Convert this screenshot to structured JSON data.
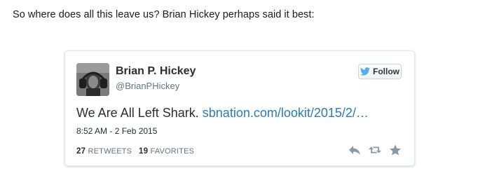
{
  "intro_text": "So where does all this leave us? Brian Hickey perhaps said it best:",
  "tweet": {
    "author_name": "Brian P. Hickey",
    "author_handle": "@BrianPHickey",
    "follow_label": "Follow",
    "text": "We Are All Left Shark.",
    "link": "sbnation.com/lookit/2015/2/…",
    "timestamp": "8:52 AM - 2 Feb 2015",
    "retweets_count": "27",
    "retweets_label": "RETWEETS",
    "favorites_count": "19",
    "favorites_label": "FAVORITES"
  },
  "colors": {
    "link": "#2b7bb9",
    "twitter_bird": "#55acee",
    "action_icons": "#8899a6"
  },
  "icons": {
    "follow": "twitter-bird-icon",
    "reply": "reply-icon",
    "retweet": "retweet-icon",
    "favorite": "star-icon"
  }
}
